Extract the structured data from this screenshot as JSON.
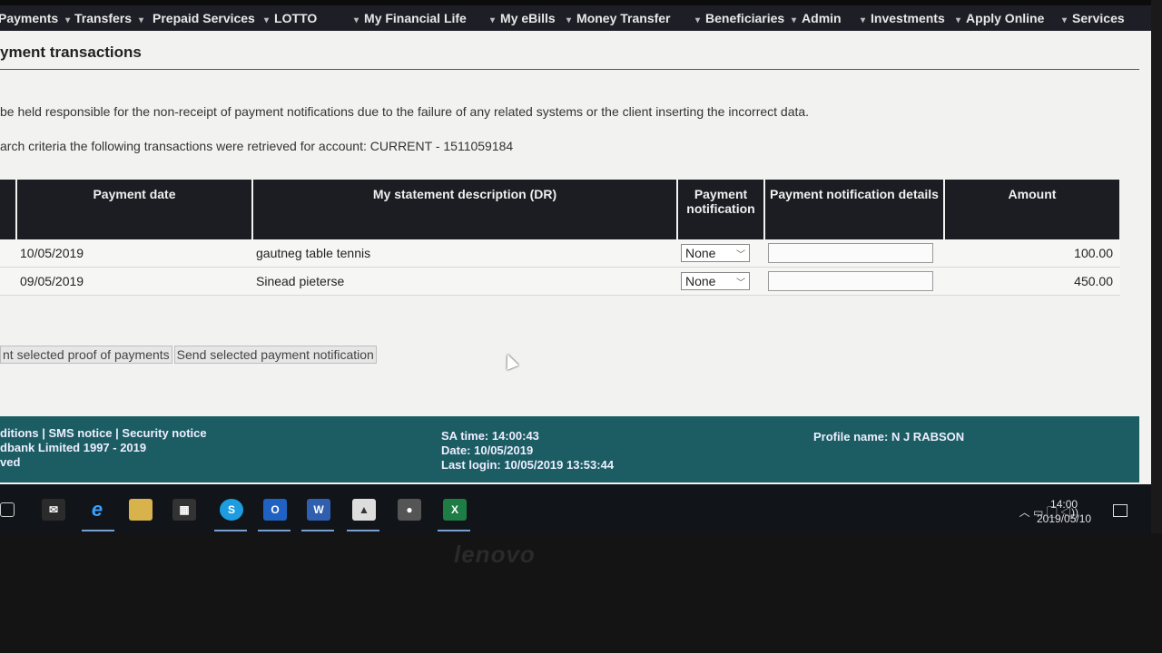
{
  "nav": {
    "items": [
      "Payments",
      "Transfers",
      "Prepaid Services",
      "LOTTO",
      "My Financial Life",
      "My eBills",
      "Money Transfer",
      "Beneficiaries",
      "Admin",
      "Investments",
      "Apply Online",
      "Services"
    ]
  },
  "page": {
    "title": "yment transactions",
    "disclaimer": "be held responsible for the non-receipt of payment notifications due to the failure of any related systems or the client inserting the incorrect data.",
    "criteria": "arch criteria the following transactions were retrieved for account: CURRENT - 1511059184"
  },
  "table": {
    "headers": [
      "Payment date",
      "My statement description (DR)",
      "Payment notification",
      "Payment notification details",
      "Amount"
    ],
    "rows": [
      {
        "date": "10/05/2019",
        "description": "gautneg table tennis",
        "notification": "None",
        "amount": "100.00"
      },
      {
        "date": "09/05/2019",
        "description": "Sinead pieterse",
        "notification": "None",
        "amount": "450.00"
      }
    ]
  },
  "actions": {
    "proof_label": "nt selected proof of payments",
    "send_label": "Send selected payment notification"
  },
  "footer": {
    "links_line": "ditions | SMS notice | Security notice",
    "copyright": "dbank Limited 1997 - 2019",
    "rights": "ved",
    "sa_time": "SA time: 14:00:43",
    "date": "Date: 10/05/2019",
    "last_login": "Last login: 10/05/2019 13:53:44",
    "profile": "Profile name: N J  RABSON"
  },
  "taskbar": {
    "time": "14:00",
    "date": "2019/05/10",
    "icons": [
      "task-view-icon",
      "mail-icon",
      "edge-icon",
      "file-explorer-icon",
      "store-icon",
      "skype-icon",
      "outlook-icon",
      "word-icon",
      "photos-icon",
      "app-icon",
      "excel-icon"
    ]
  },
  "bezel": {
    "brand": "lenovo"
  },
  "colors": {
    "nav_bg": "#1e1e26",
    "header_bg": "#1c1d22",
    "footer_bg": "#1b5d63",
    "taskbar_bg": "#111419"
  }
}
